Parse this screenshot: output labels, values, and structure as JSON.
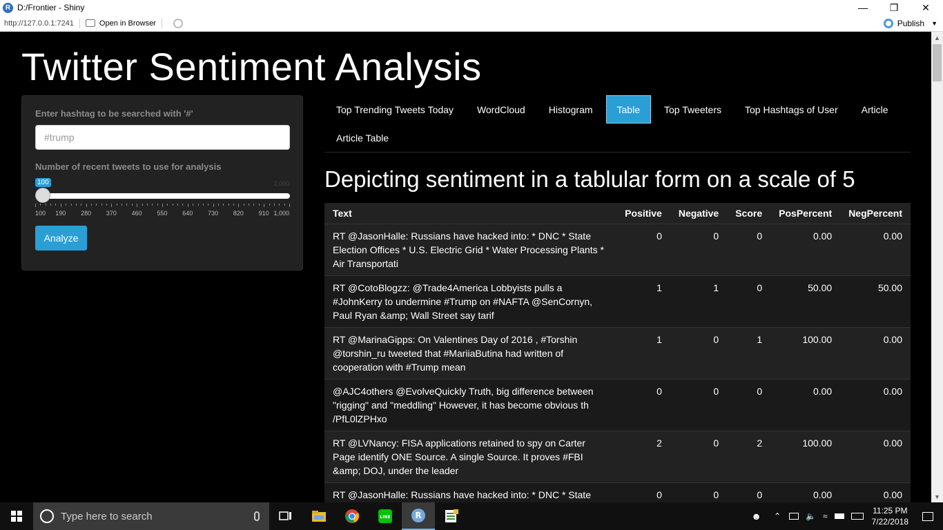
{
  "window": {
    "title": "D:/Frontier - Shiny",
    "url": "http://127.0.0.1:7241",
    "open_in_browser": "Open in Browser",
    "publish": "Publish",
    "minimize_icon": "—",
    "maximize_icon": "❐",
    "close_icon": "✕"
  },
  "app": {
    "title": "Twitter Sentiment Analysis"
  },
  "sidebar": {
    "hashtag_label": "Enter hashtag to be searched with '#'",
    "hashtag_placeholder": "#trump",
    "tweets_label": "Number of recent tweets to use for analysis",
    "slider": {
      "value": 100,
      "value_label": "100",
      "max_label": "1,000",
      "min": 100,
      "max": 1000,
      "tick_labels": [
        "100",
        "190",
        "280",
        "370",
        "460",
        "550",
        "640",
        "730",
        "820",
        "910",
        "1,000"
      ]
    },
    "analyze_label": "Analyze"
  },
  "tabs": [
    {
      "label": "Top Trending Tweets Today",
      "active": false
    },
    {
      "label": "WordCloud",
      "active": false
    },
    {
      "label": "Histogram",
      "active": false
    },
    {
      "label": "Table",
      "active": true
    },
    {
      "label": "Top Tweeters",
      "active": false
    },
    {
      "label": "Top Hashtags of User",
      "active": false
    },
    {
      "label": "Article",
      "active": false
    },
    {
      "label": "Article Table",
      "active": false
    }
  ],
  "panel": {
    "title": "Depicting sentiment in a tablular form on a scale of 5"
  },
  "table": {
    "columns": [
      "Text",
      "Positive",
      "Negative",
      "Score",
      "PosPercent",
      "NegPercent"
    ],
    "rows": [
      [
        "RT @JasonHalle: Russians have hacked into: * DNC * State Election Offices * U.S. Electric Grid * Water Processing Plants * Air Transportati",
        "0",
        "0",
        "0",
        "0.00",
        "0.00"
      ],
      [
        "RT @CotoBlogzz: @Trade4America Lobbyists pulls a #JohnKerry to undermine #Trump on #NAFTA @SenCornyn, Paul Ryan &amp; Wall Street say tarif",
        "1",
        "1",
        "0",
        "50.00",
        "50.00"
      ],
      [
        "RT @MarinaGipps: On Valentines Day of 2016 , #Torshin @torshin_ru tweeted that #MariiaButina had written of cooperation with #Trump mean",
        "1",
        "0",
        "1",
        "100.00",
        "0.00"
      ],
      [
        "@AJC4others @EvolveQuickly Truth, big difference between \"rigging\" and \"meddling\" However, it has become obvious th /PfL0lZPHxo",
        "0",
        "0",
        "0",
        "0.00",
        "0.00"
      ],
      [
        "RT @LVNancy: FISA applications retained to spy on Carter Page identify ONE Source. A single Source. It proves #FBI &amp; DOJ, under the leader",
        "2",
        "0",
        "2",
        "100.00",
        "0.00"
      ],
      [
        "RT @JasonHalle: Russians have hacked into: * DNC * State Election Offices * U.S. Electric Grid * Water Processing Plants * Air Transportati",
        "0",
        "0",
        "0",
        "0.00",
        "0.00"
      ]
    ]
  },
  "taskbar": {
    "search_placeholder": "Type here to search",
    "time": "11:25 PM",
    "date": "7/22/2018",
    "apps": [
      "task-view-icon",
      "file-explorer-icon",
      "chrome-icon",
      "line-icon",
      "rstudio-icon",
      "spreadsheet-icon"
    ]
  },
  "colors": {
    "accent": "#2a9fd6",
    "background": "#000000",
    "panel": "#222222"
  }
}
